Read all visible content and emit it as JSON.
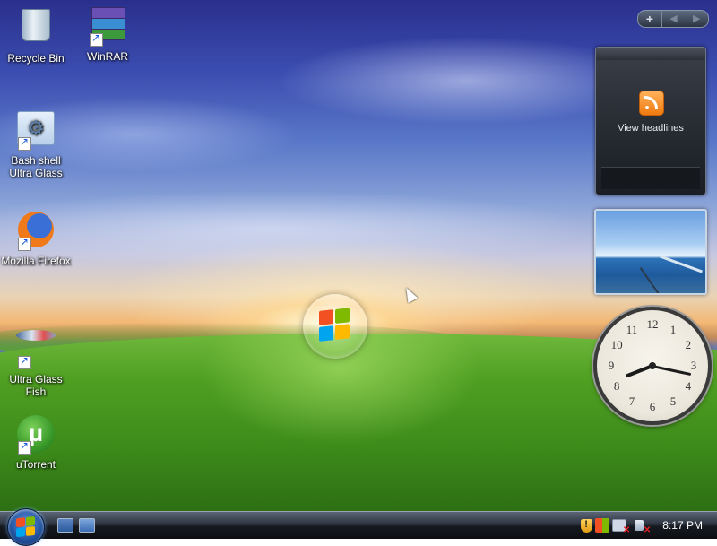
{
  "desktop": {
    "icons": [
      {
        "label": "Recycle Bin",
        "icon": "recycle-bin-icon"
      },
      {
        "label": "WinRAR",
        "icon": "winrar-icon",
        "shortcut": true
      },
      {
        "label": "Bash shell Ultra Glass",
        "icon": "gears-icon",
        "shortcut": true
      },
      {
        "label": "Mozilla Firefox",
        "icon": "firefox-icon",
        "shortcut": true
      },
      {
        "label": "Ultra Glass Fish",
        "icon": "fish-icon",
        "shortcut": true
      },
      {
        "label": "uTorrent",
        "icon": "utorrent-icon",
        "shortcut": true
      }
    ]
  },
  "sidebar": {
    "controls": {
      "add": "+",
      "prev": "◀",
      "next": "▶"
    },
    "feed_gadget": {
      "label": "View headlines",
      "icon": "rss-icon"
    },
    "slideshow_gadget": {
      "image": "ocean-dock-photo"
    },
    "clock_gadget": {
      "numbers": [
        "12",
        "1",
        "2",
        "3",
        "4",
        "5",
        "6",
        "7",
        "8",
        "9",
        "10",
        "11"
      ],
      "hour": 8,
      "minute": 17
    }
  },
  "taskbar": {
    "start": "start-orb-icon",
    "quick_launch": [
      "show-desktop-icon",
      "switch-windows-icon"
    ],
    "tray": [
      "security-alert-icon",
      "windows-update-icon",
      "network-disconnected-icon",
      "volume-muted-icon"
    ],
    "time": "8:17 PM"
  },
  "colors": {
    "taskbar": "#15191f",
    "accent": "#1f4f9a"
  }
}
